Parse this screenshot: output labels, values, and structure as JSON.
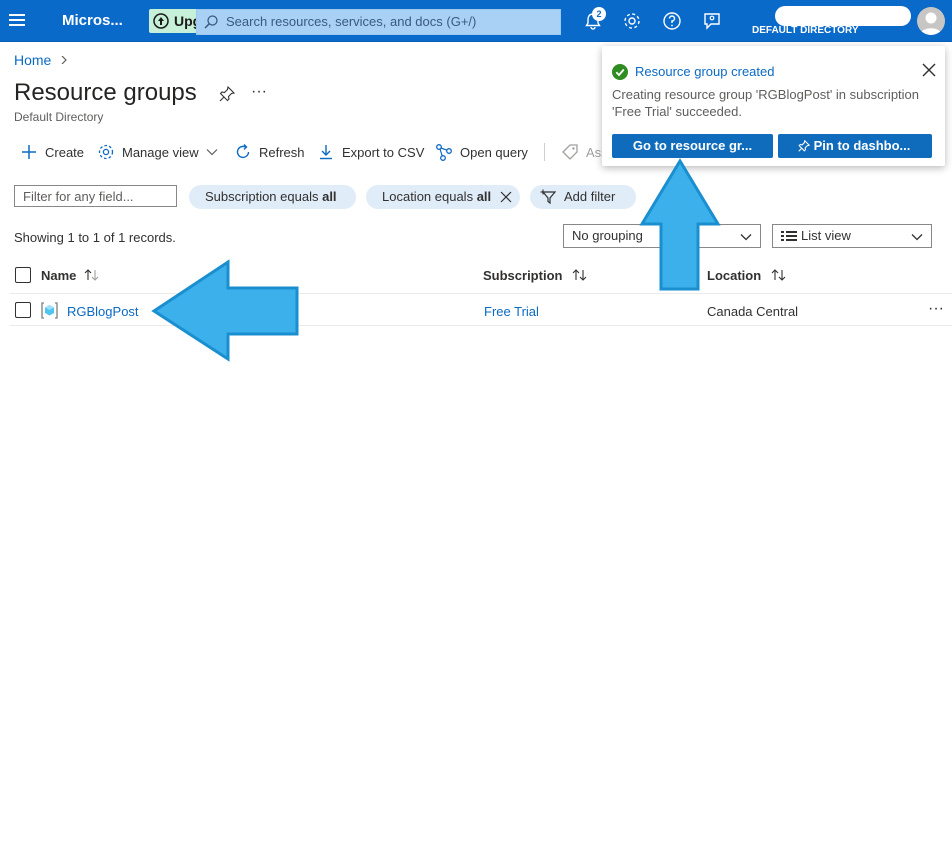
{
  "topbar": {
    "brand": "Micros...",
    "upgrade_label": "Upg",
    "search_placeholder": "Search resources, services, and docs (G+/)",
    "notification_count": "2",
    "account_directory": "DEFAULT DIRECTORY",
    "bar_color": "#0a6ac9"
  },
  "breadcrumb": {
    "home": "Home"
  },
  "page": {
    "title": "Resource groups",
    "subtitle": "Default Directory",
    "more": "···"
  },
  "commands": {
    "create": "Create",
    "manage_view": "Manage view",
    "refresh": "Refresh",
    "export_csv": "Export to CSV",
    "open_query": "Open query",
    "assign_tags": "Ass"
  },
  "filters": {
    "input_placeholder": "Filter for any field...",
    "subscription_prefix": "Subscription equals",
    "subscription_value": "all",
    "location_prefix": "Location equals",
    "location_value": "all",
    "add_filter": "Add filter"
  },
  "records_text": "Showing 1 to 1 of 1 records.",
  "grouping": {
    "selected": "No grouping"
  },
  "view": {
    "selected": "List view"
  },
  "table": {
    "columns": {
      "name": "Name",
      "subscription": "Subscription",
      "location": "Location"
    },
    "rows": [
      {
        "name": "RGBlogPost",
        "subscription": "Free Trial",
        "location": "Canada Central",
        "more": "···"
      }
    ]
  },
  "toast": {
    "title": "Resource group created",
    "body": "Creating resource group 'RGBlogPost' in subscription 'Free Trial' succeeded.",
    "go_button": "Go to resource gr...",
    "pin_button": "Pin to dashbo..."
  },
  "colors": {
    "accent": "#0b6ac4",
    "callout_arrow": "#3cb0ea",
    "success": "#2e8c22"
  },
  "icons": [
    "hamburger-icon",
    "upgrade-icon",
    "search-icon",
    "bell-icon",
    "gear-icon",
    "help-icon",
    "feedback-icon",
    "avatar-icon",
    "pin-icon",
    "plus-icon",
    "settings-icon",
    "refresh-icon",
    "download-icon",
    "query-icon",
    "tag-icon",
    "filter-icon",
    "chevron-down-icon",
    "sort-icon",
    "resource-group-icon",
    "checkmark-icon",
    "close-icon"
  ]
}
